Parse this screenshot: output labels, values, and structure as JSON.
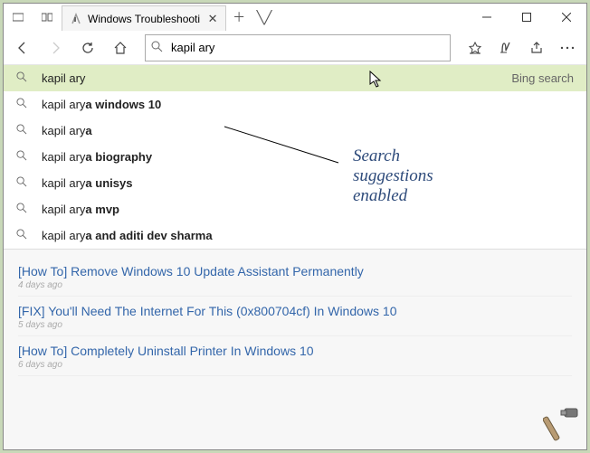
{
  "window": {
    "title": "Windows Troubleshooti"
  },
  "toolbar": {
    "search_value": "kapil ary",
    "bing_label": "Bing search"
  },
  "suggestions": [
    {
      "pre": "kapil ary",
      "bold": ""
    },
    {
      "pre": "kapil ary",
      "bold": "a windows 10"
    },
    {
      "pre": "kapil ary",
      "bold": "a"
    },
    {
      "pre": "kapil ary",
      "bold": "a biography"
    },
    {
      "pre": "kapil ary",
      "bold": "a unisys"
    },
    {
      "pre": "kapil ary",
      "bold": "a mvp"
    },
    {
      "pre": "kapil ary",
      "bold": "a and aditi dev sharma"
    }
  ],
  "posts": [
    {
      "title": "[How To] Remove Windows 10 Update Assistant Permanently",
      "age": "4 days ago"
    },
    {
      "title": "[FIX] You'll Need The Internet For This (0x800704cf) In Windows 10",
      "age": "5 days ago"
    },
    {
      "title": "[How To] Completely Uninstall Printer In Windows 10",
      "age": "6 days ago"
    }
  ],
  "annotation": {
    "line1": "Search",
    "line2": "suggestions",
    "line3": "enabled"
  }
}
